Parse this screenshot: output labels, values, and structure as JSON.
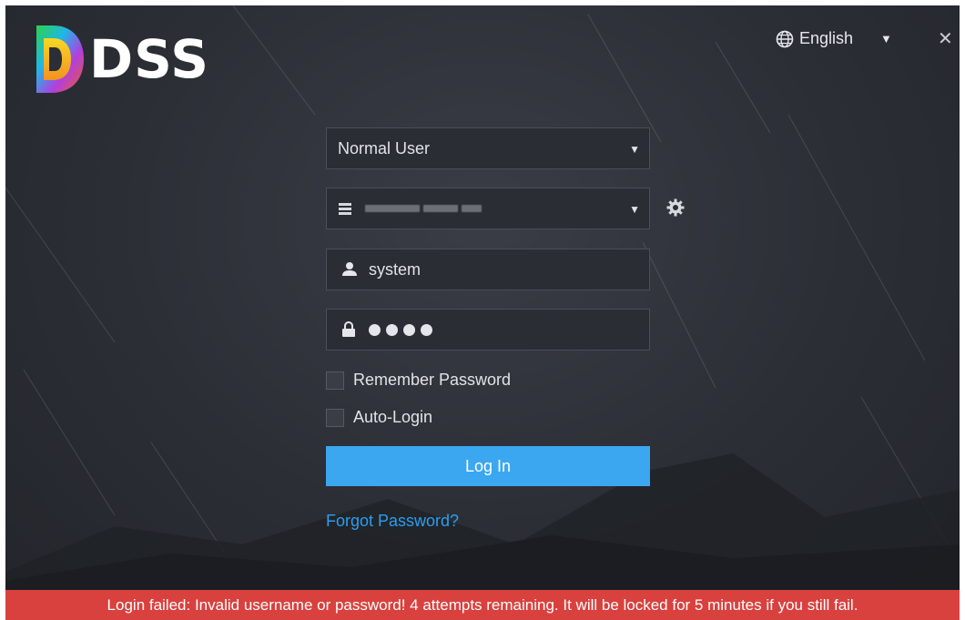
{
  "app": {
    "logo_text": "DSS"
  },
  "header": {
    "language": "English"
  },
  "form": {
    "user_type": "Normal User",
    "username": "system",
    "password_dot_count": 4,
    "remember_password_label": "Remember Password",
    "remember_password_checked": false,
    "auto_login_label": "Auto-Login",
    "auto_login_checked": false,
    "login_button": "Log In",
    "forgot_password": "Forgot Password?"
  },
  "error": {
    "message": "Login failed: Invalid username or password! 4 attempts remaining. It will be locked for 5 minutes if you still fail."
  },
  "colors": {
    "accent": "#3aa7f0",
    "error": "#d9413e",
    "link": "#2a9ef0",
    "background": "#2b2e35"
  }
}
